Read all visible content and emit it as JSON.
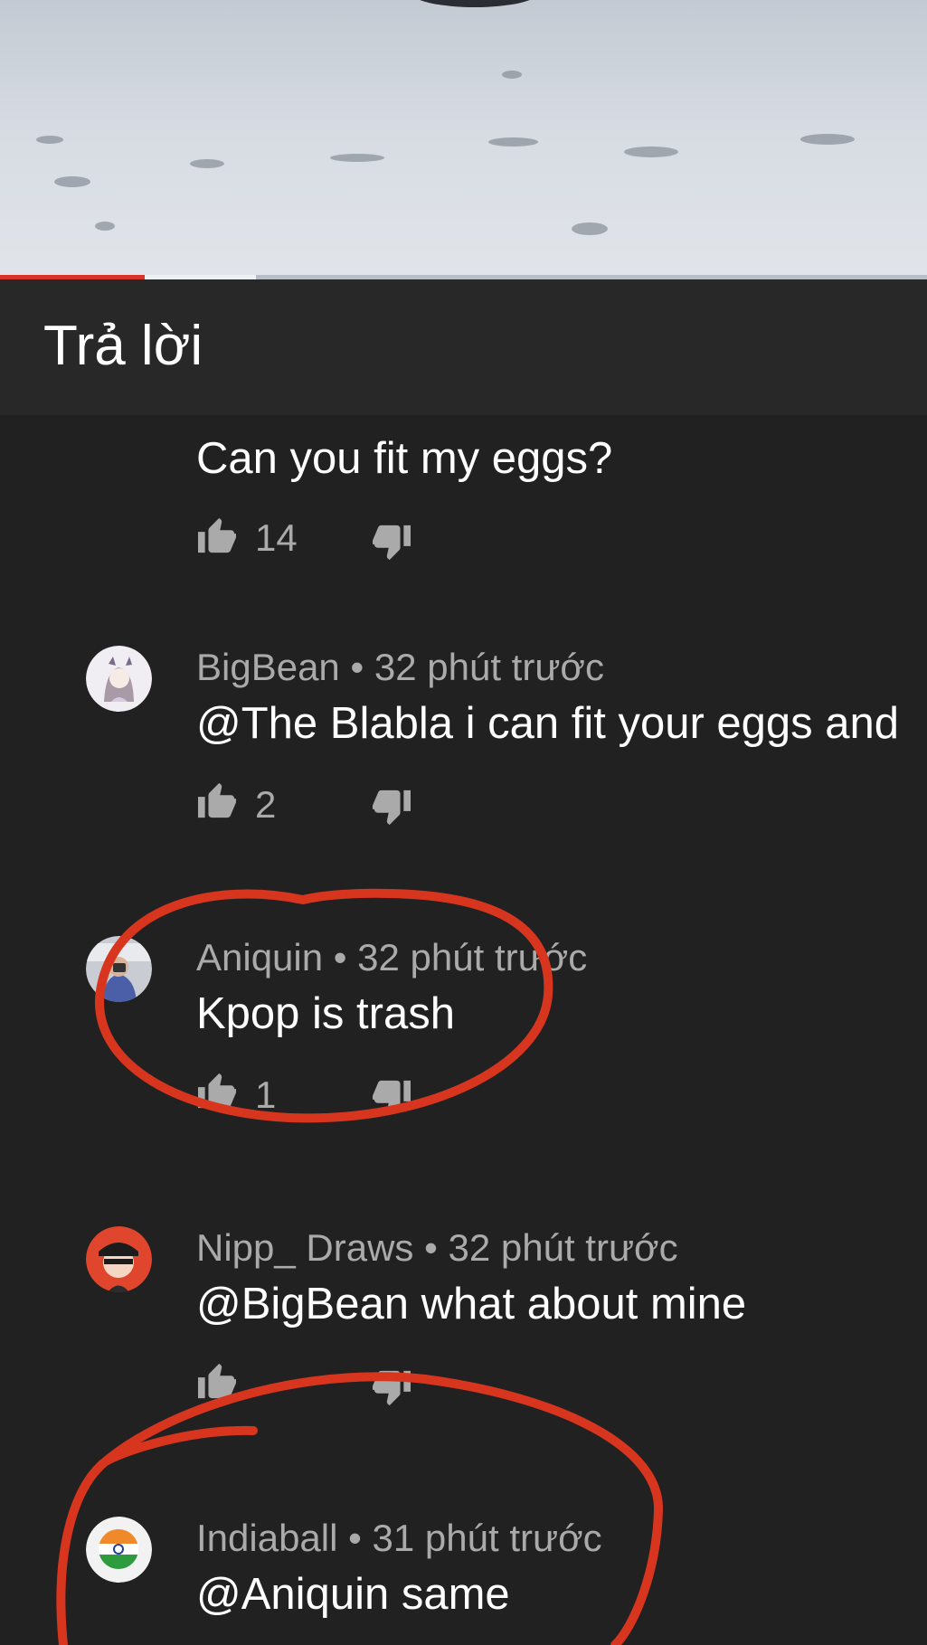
{
  "header": {
    "title": "Trả lời"
  },
  "video": {
    "progress_played": 0.156,
    "progress_buffered": 0.276
  },
  "comments": [
    {
      "text": "Can you fit my eggs?",
      "likes": "14"
    },
    {
      "author": "BigBean",
      "sep": "•",
      "time": "32 phút trước",
      "text": "@The Blabla i can fit your eggs and",
      "likes": "2"
    },
    {
      "author": "Aniquin",
      "sep": "•",
      "time": "32 phút trước",
      "text": "Kpop is trash",
      "likes": "1"
    },
    {
      "author": "Nipp_ Draws",
      "sep": "•",
      "time": "32 phút trước",
      "text": "@BigBean what about mine",
      "likes": ""
    },
    {
      "author": "Indiaball",
      "sep": "•",
      "time": "31 phút trước",
      "text": "@Aniquin same"
    }
  ],
  "colors": {
    "background": "#212121",
    "header": "#282828",
    "annotation": "#d8351f",
    "progress": "#d8352a"
  },
  "icons": {
    "like": "thumbs-up-icon",
    "dislike": "thumbs-down-icon"
  }
}
